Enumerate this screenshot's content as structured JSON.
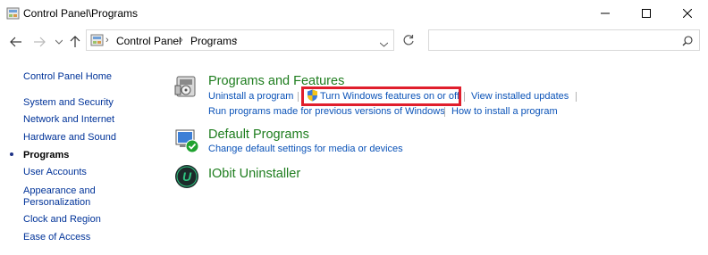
{
  "window": {
    "title": "Control Panel\\Programs"
  },
  "address": {
    "crumbs": [
      "Control Panel",
      "Programs"
    ]
  },
  "search": {
    "placeholder": ""
  },
  "sidebar": {
    "items": [
      {
        "label": "Control Panel Home",
        "current": false
      },
      {
        "label": "System and Security",
        "current": false
      },
      {
        "label": "Network and Internet",
        "current": false
      },
      {
        "label": "Hardware and Sound",
        "current": false
      },
      {
        "label": "Programs",
        "current": true
      },
      {
        "label": "User Accounts",
        "current": false
      },
      {
        "label": "Appearance and",
        "current": false
      },
      {
        "label": "Personalization",
        "current": false
      },
      {
        "label": "Clock and Region",
        "current": false
      },
      {
        "label": "Ease of Access",
        "current": false
      }
    ]
  },
  "categories": [
    {
      "title": "Programs and Features",
      "icon": "programs-features-icon",
      "links": [
        "Uninstall a program",
        "Turn Windows features on or off",
        "View installed updates",
        "Run programs made for previous versions of Windows",
        "How to install a program"
      ]
    },
    {
      "title": "Default Programs",
      "icon": "default-programs-icon",
      "links": [
        "Change default settings for media or devices"
      ]
    },
    {
      "title": "IObit Uninstaller",
      "icon": "iobit-icon",
      "links": []
    }
  ],
  "colors": {
    "category_title": "#1e7d1e",
    "link": "#0b53b8",
    "sidebar_link": "#003399",
    "highlight_box": "#e01e2c"
  }
}
